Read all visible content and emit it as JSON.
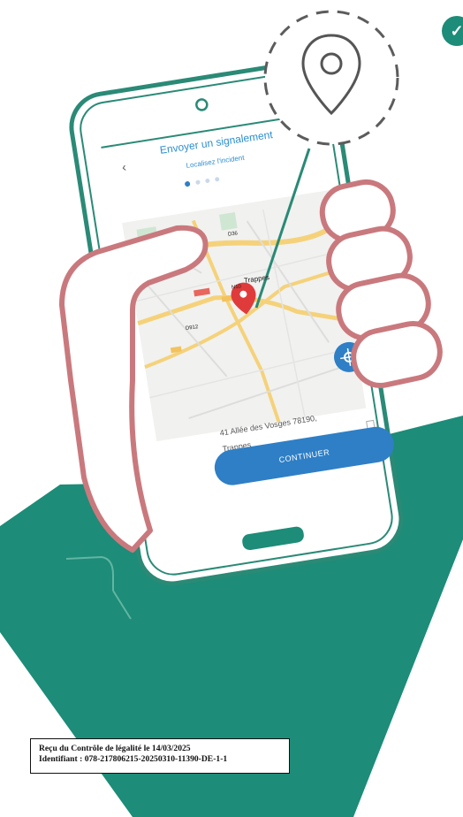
{
  "app_screen": {
    "title": "Envoyer un signalement",
    "subtitle": "Localisez l'incident",
    "back_icon": "chevron-left-icon",
    "step_indicator": {
      "total_steps": 4,
      "current_step": 1
    },
    "map": {
      "place_label": "Trappes",
      "road_labels": [
        "D36",
        "N10",
        "D912"
      ],
      "location_pin_icon": "map-pin-icon",
      "locate_button_icon": "crosshair-icon"
    },
    "address": {
      "line": "41 Allée des Vosges 78190,",
      "city": "Trappes",
      "copy_icon": "copy-icon"
    },
    "continue_label": "CONTINUER"
  },
  "decor": {
    "badge_icon": "checkmark-icon",
    "large_pin_icon": "map-pin-icon",
    "colors": {
      "teal": "#1d8c78",
      "phone_outline": "#2a8a76",
      "hand_outline": "#c9797d",
      "primary_blue": "#2e7fc6",
      "pin_red": "#e03b3b"
    }
  },
  "stamp": {
    "line1": "Reçu du Contrôle de légalité le 14/03/2025",
    "line2": "Identifiant : 078-217806215-20250310-11390-DE-1-1"
  }
}
